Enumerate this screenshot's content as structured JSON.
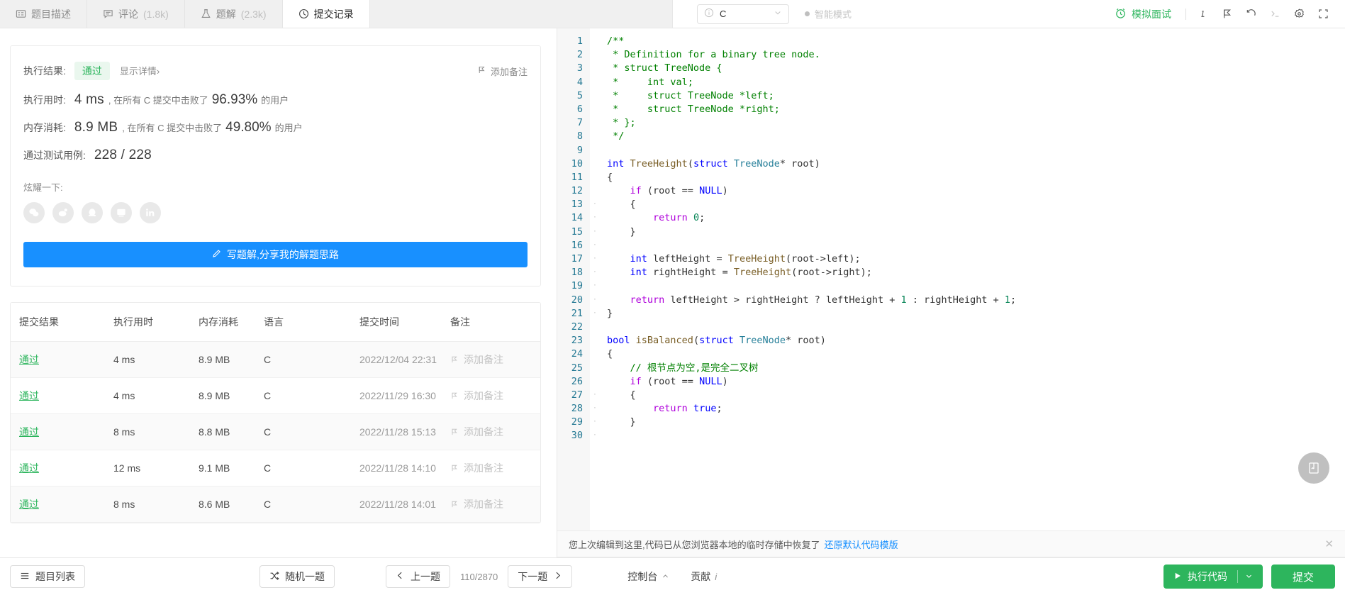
{
  "tabs": [
    {
      "icon": "description-icon",
      "label": "题目描述",
      "count": "",
      "active": false
    },
    {
      "icon": "comment-icon",
      "label": "评论",
      "count": "(1.8k)",
      "active": false
    },
    {
      "icon": "flask-icon",
      "label": "题解",
      "count": "(2.3k)",
      "active": false
    },
    {
      "icon": "clock-icon",
      "label": "提交记录",
      "count": "",
      "active": true
    }
  ],
  "toolbar": {
    "language": "C",
    "smart_mode": "智能模式",
    "mock_interview": "模拟面试",
    "icons": [
      "info-icon",
      "flag-icon",
      "undo-icon",
      "console-icon",
      "settings-icon",
      "fullscreen-icon"
    ]
  },
  "result": {
    "status_label": "执行结果:",
    "status_value": "通过",
    "detail_link": "显示详情",
    "detail_chevron": "›",
    "runtime_label": "执行用时:",
    "runtime_value": "4 ms",
    "runtime_mid": ", 在所有 C 提交中击败了",
    "runtime_pct": "96.93%",
    "runtime_suffix": "的用户",
    "memory_label": "内存消耗:",
    "memory_value": "8.9 MB",
    "memory_mid": ", 在所有 C 提交中击败了",
    "memory_pct": "49.80%",
    "memory_suffix": "的用户",
    "cases_label": "通过测试用例:",
    "cases_value": "228 / 228",
    "add_note": "添加备注",
    "share_label": "炫耀一下:",
    "share_icons": [
      "wechat-icon",
      "weibo-icon",
      "qq-icon",
      "douban-icon",
      "linkedin-icon"
    ],
    "write_solution": "写题解,分享我的解题思路"
  },
  "table": {
    "headers": [
      "提交结果",
      "执行用时",
      "内存消耗",
      "语言",
      "提交时间",
      "备注"
    ],
    "rows": [
      {
        "status": "通过",
        "runtime": "4 ms",
        "memory": "8.9 MB",
        "lang": "C",
        "time": "2022/12/04 22:31",
        "note": "添加备注"
      },
      {
        "status": "通过",
        "runtime": "4 ms",
        "memory": "8.9 MB",
        "lang": "C",
        "time": "2022/11/29 16:30",
        "note": "添加备注"
      },
      {
        "status": "通过",
        "runtime": "8 ms",
        "memory": "8.8 MB",
        "lang": "C",
        "time": "2022/11/28 15:13",
        "note": "添加备注"
      },
      {
        "status": "通过",
        "runtime": "12 ms",
        "memory": "9.1 MB",
        "lang": "C",
        "time": "2022/11/28 14:10",
        "note": "添加备注"
      },
      {
        "status": "通过",
        "runtime": "8 ms",
        "memory": "8.6 MB",
        "lang": "C",
        "time": "2022/11/28 14:01",
        "note": "添加备注"
      }
    ]
  },
  "code": {
    "lines": [
      "/**",
      " * Definition for a binary tree node.",
      " * struct TreeNode {",
      " *     int val;",
      " *     struct TreeNode *left;",
      " *     struct TreeNode *right;",
      " * };",
      " */",
      "",
      "int TreeHeight(struct TreeNode* root)",
      "{",
      "    if (root == NULL)",
      "    {",
      "        return 0;",
      "    }",
      "",
      "    int leftHeight = TreeHeight(root->left);",
      "    int rightHeight = TreeHeight(root->right);",
      "",
      "    return leftHeight > rightHeight ? leftHeight + 1 : rightHeight + 1;",
      "}",
      "",
      "bool isBalanced(struct TreeNode* root)",
      "{",
      "    // 根节点为空,是完全二叉树",
      "    if (root == NULL)",
      "    {",
      "        return true;",
      "    }",
      ""
    ],
    "first_line": 1
  },
  "notice": {
    "text": "您上次编辑到这里,代码已从您浏览器本地的临时存储中恢复了",
    "link": "还原默认代码模版",
    "close": "✕"
  },
  "bottom": {
    "problem_list": "题目列表",
    "random": "随机一题",
    "prev": "上一题",
    "next": "下一题",
    "counter": "110/2870",
    "console": "控制台",
    "contribute": "贡献",
    "run_code": "执行代码",
    "submit": "提交"
  },
  "colors": {
    "accent_blue": "#1890ff",
    "accent_green": "#2db55d",
    "pass_bg": "#eaf7ee",
    "muted": "#8c8c8c"
  }
}
